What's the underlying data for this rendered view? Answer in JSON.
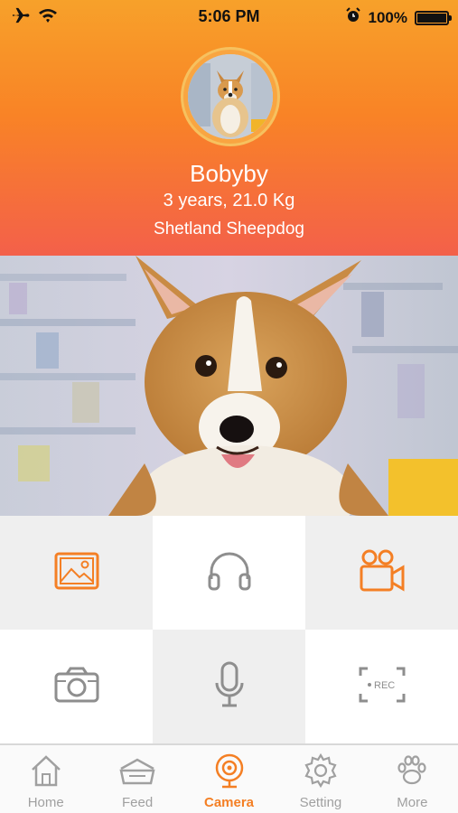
{
  "status_bar": {
    "time": "5:06 PM",
    "battery": "100%"
  },
  "pet": {
    "name": "Bobyby",
    "info": "3 years, 21.0 Kg",
    "breed": "Shetland Sheepdog"
  },
  "actions": [
    {
      "icon": "gallery-icon",
      "color": "#f47f24"
    },
    {
      "icon": "headphones-icon",
      "color": "#8e8e8e"
    },
    {
      "icon": "video-camera-icon",
      "color": "#f47f24"
    },
    {
      "icon": "camera-icon",
      "color": "#8e8e8e"
    },
    {
      "icon": "microphone-icon",
      "color": "#8e8e8e"
    },
    {
      "icon": "record-icon",
      "label": "REC",
      "color": "#8e8e8e"
    }
  ],
  "tabs": [
    {
      "label": "Home",
      "icon": "home-icon"
    },
    {
      "label": "Feed",
      "icon": "feed-bowl-icon"
    },
    {
      "label": "Camera",
      "icon": "webcam-icon",
      "active": true
    },
    {
      "label": "Setting",
      "icon": "gear-icon"
    },
    {
      "label": "More",
      "icon": "paw-icon"
    }
  ],
  "colors": {
    "accent": "#f47f24",
    "icon_gray": "#8e8e8e",
    "header_top": "#f7a12a",
    "header_bottom": "#f3604a"
  }
}
